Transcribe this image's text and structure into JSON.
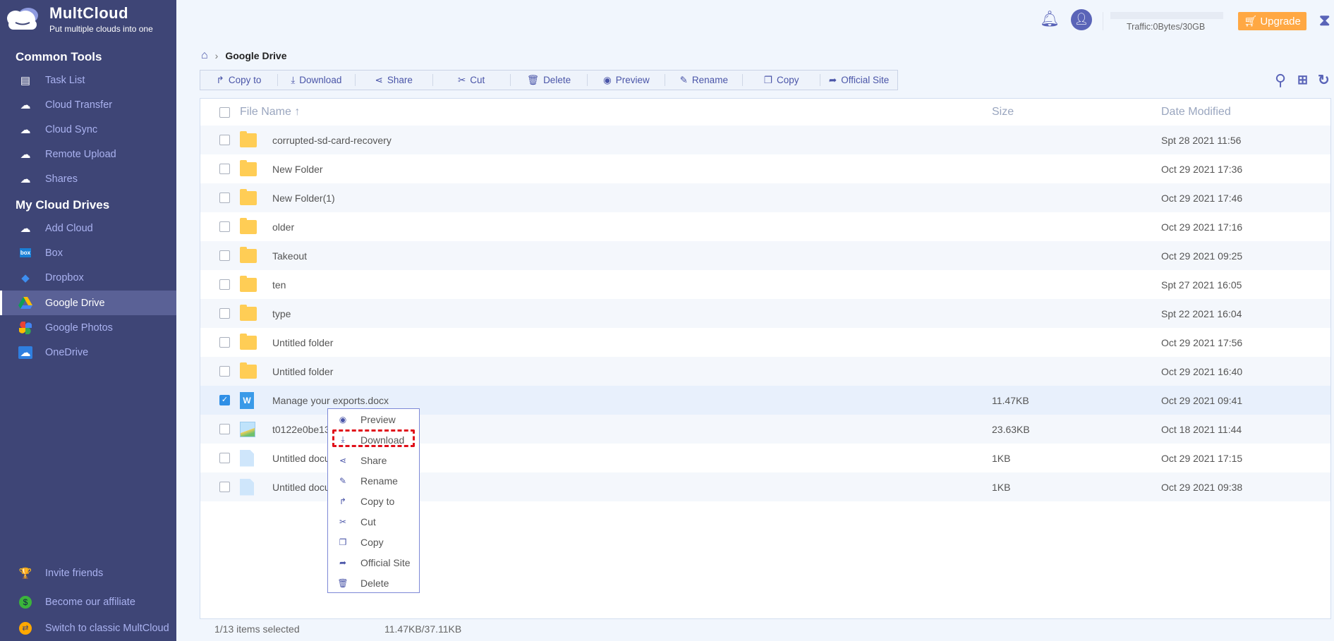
{
  "brand": {
    "title": "MultCloud",
    "subtitle": "Put multiple clouds into one"
  },
  "sidebar": {
    "common_tools_heading": "Common Tools",
    "common_tools": [
      {
        "label": "Task List",
        "icon": "clipboard-icon"
      },
      {
        "label": "Cloud Transfer",
        "icon": "cloud-transfer-icon"
      },
      {
        "label": "Cloud Sync",
        "icon": "cloud-sync-icon"
      },
      {
        "label": "Remote Upload",
        "icon": "cloud-upload-icon"
      },
      {
        "label": "Shares",
        "icon": "share-cloud-icon"
      }
    ],
    "drives_heading": "My Cloud Drives",
    "drives": [
      {
        "label": "Add Cloud"
      },
      {
        "label": "Box"
      },
      {
        "label": "Dropbox"
      },
      {
        "label": "Google Drive",
        "active": true
      },
      {
        "label": "Google Photos"
      },
      {
        "label": "OneDrive"
      }
    ],
    "bottom": [
      {
        "label": "Invite friends"
      },
      {
        "label": "Become our affiliate"
      },
      {
        "label": "Switch to classic MultCloud"
      }
    ]
  },
  "header": {
    "traffic": "Traffic:0Bytes/30GB",
    "upgrade": "Upgrade",
    "traffic_used_fraction": 0
  },
  "breadcrumb": {
    "current": "Google Drive"
  },
  "toolbar": [
    "Copy to",
    "Download",
    "Share",
    "Cut",
    "Delete",
    "Preview",
    "Rename",
    "Copy",
    "Official Site"
  ],
  "table": {
    "headers": {
      "name": "File Name",
      "size": "Size",
      "date": "Date Modified"
    },
    "rows": [
      {
        "name": "corrupted-sd-card-recovery",
        "size": "",
        "date": "Spt 28 2021 11:56",
        "type": "folder"
      },
      {
        "name": "New Folder",
        "size": "",
        "date": "Oct 29 2021 17:36",
        "type": "folder"
      },
      {
        "name": "New Folder(1)",
        "size": "",
        "date": "Oct 29 2021 17:46",
        "type": "folder"
      },
      {
        "name": "older",
        "size": "",
        "date": "Oct 29 2021 17:16",
        "type": "folder"
      },
      {
        "name": "Takeout",
        "size": "",
        "date": "Oct 29 2021 09:25",
        "type": "folder"
      },
      {
        "name": "ten",
        "size": "",
        "date": "Spt 27 2021 16:05",
        "type": "folder"
      },
      {
        "name": "type",
        "size": "",
        "date": "Spt 22 2021 16:04",
        "type": "folder"
      },
      {
        "name": "Untitled folder",
        "size": "",
        "date": "Oct 29 2021 17:56",
        "type": "folder"
      },
      {
        "name": "Untitled folder",
        "size": "",
        "date": "Oct 29 2021 16:40",
        "type": "folder"
      },
      {
        "name": "Manage your exports.docx",
        "size": "11.47KB",
        "date": "Oct 29 2021 09:41",
        "type": "word",
        "selected": true
      },
      {
        "name": "t0122e0be13",
        "size": "23.63KB",
        "date": "Oct 18 2021 11:44",
        "type": "image"
      },
      {
        "name": "Untitled docu",
        "size": "1KB",
        "date": "Oct 29 2021 17:15",
        "type": "doc"
      },
      {
        "name": "Untitled docu",
        "size": "1KB",
        "date": "Oct 29 2021 09:38",
        "type": "doc"
      }
    ]
  },
  "context_menu": [
    "Preview",
    "Download",
    "Share",
    "Rename",
    "Copy to",
    "Cut",
    "Copy",
    "Official Site",
    "Delete"
  ],
  "footer": {
    "selected": "1/13 items selected",
    "size": "11.47KB/37.11KB"
  }
}
